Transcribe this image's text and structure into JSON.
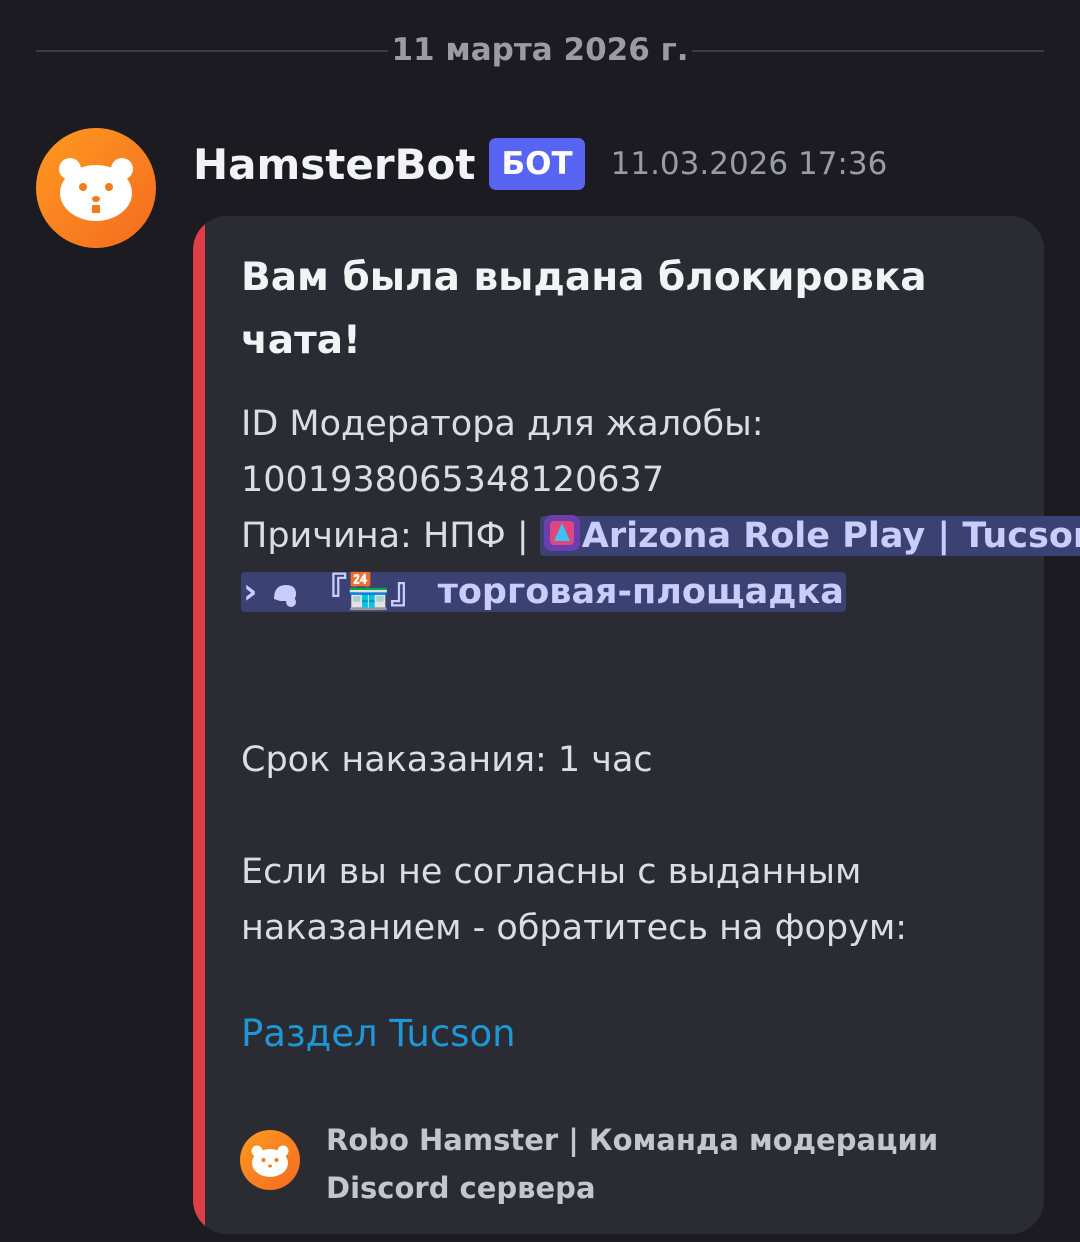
{
  "date_divider": "11 марта 2026 г.",
  "message": {
    "author": "HamsterBot",
    "bot_badge": "БОТ",
    "timestamp": "11.03.2026 17:36",
    "avatar_icon": "hamster-icon"
  },
  "embed": {
    "accent_color": "#e03e46",
    "title": "Вам была выдана блокировка чата!",
    "moderator_label": "ID Модератора для жалобы:",
    "moderator_id": "1001938065348120637",
    "reason_label": "Причина: НПФ |",
    "channel_mention": {
      "server": "Arizona Role Play | Tucson",
      "separator": "›",
      "channel": "『🏪』 торговая-площадка",
      "icons": [
        "server-icon",
        "forum-channel-icon"
      ]
    },
    "punishment_term": "Срок наказания: 1 час",
    "appeal_line_1": "Если вы не согласны с выданным",
    "appeal_line_2": "наказанием - обратитесь на форум:",
    "forum_link": "Раздел Tucson",
    "footer": "Robo Hamster | Команда модерации Discord сервера"
  }
}
